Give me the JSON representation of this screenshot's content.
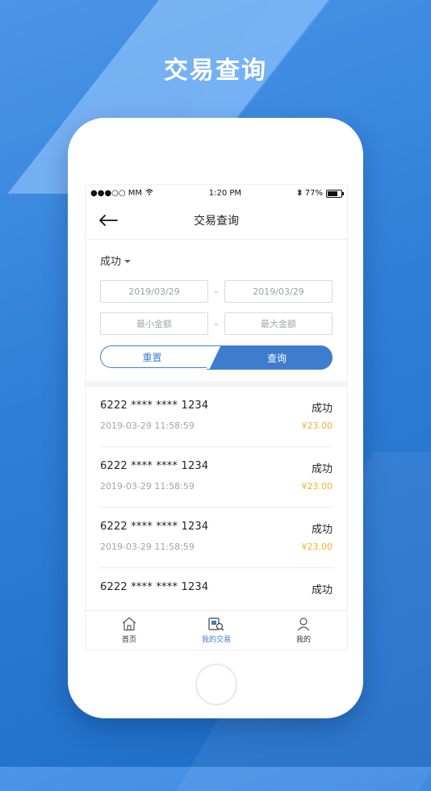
{
  "headline": "交易查询",
  "statusbar": {
    "carrier": "●●●○○ MM",
    "time": "1:20 PM",
    "battery": "77%"
  },
  "navbar": {
    "title": "交易查询"
  },
  "filter": {
    "status": "成功",
    "start_date": "2019/03/29",
    "end_date": "2019/03/29",
    "min_amount_placeholder": "最小金额",
    "max_amount_placeholder": "最大金额",
    "separator": "–",
    "reset_label": "重置",
    "query_label": "查询"
  },
  "transactions": [
    {
      "card": "6222 **** **** 1234",
      "status": "成功",
      "time": "2019-03-29 11:58:59",
      "amount": "¥23.00"
    },
    {
      "card": "6222 **** **** 1234",
      "status": "成功",
      "time": "2019-03-29 11:58:59",
      "amount": "¥23.00"
    },
    {
      "card": "6222 **** **** 1234",
      "status": "成功",
      "time": "2019-03-29 11:58:59",
      "amount": "¥23.00"
    },
    {
      "card": "6222 **** **** 1234",
      "status": "成功",
      "time": "",
      "amount": ""
    }
  ],
  "tabbar": {
    "items": [
      {
        "label": "首页",
        "icon": "home-icon"
      },
      {
        "label": "我的交易",
        "icon": "transactions-search-icon",
        "active": true
      },
      {
        "label": "我的",
        "icon": "user-icon"
      }
    ]
  },
  "colors": {
    "accent": "#3e7ccd",
    "amount": "#f2b230",
    "background": "#2f7fd8"
  }
}
